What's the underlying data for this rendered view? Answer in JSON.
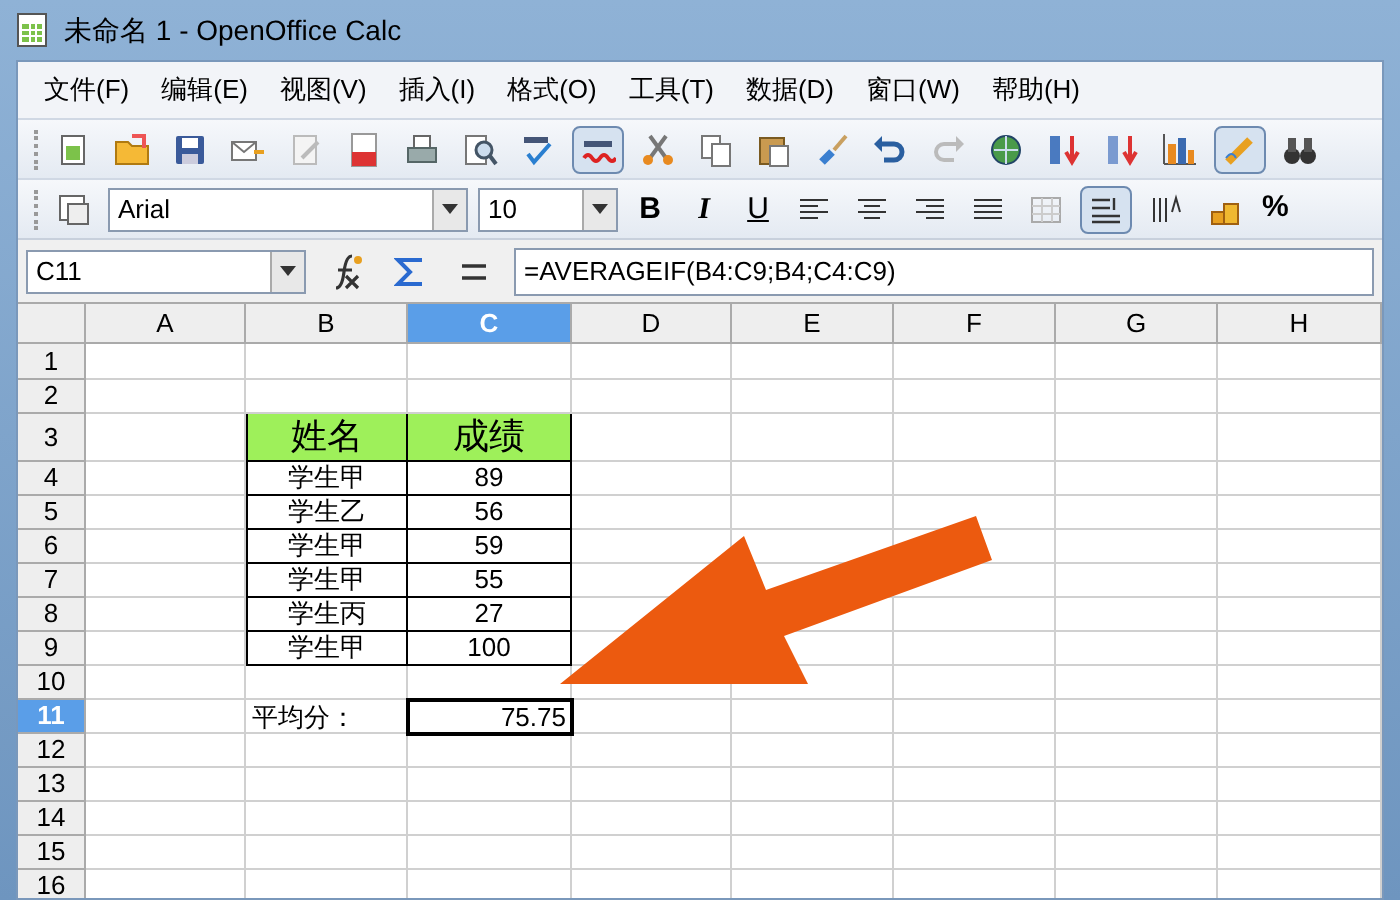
{
  "window": {
    "title": "未命名 1 - OpenOffice Calc"
  },
  "menu": [
    {
      "label": "文件(F)"
    },
    {
      "label": "编辑(E)"
    },
    {
      "label": "视图(V)"
    },
    {
      "label": "插入(I)"
    },
    {
      "label": "格式(O)"
    },
    {
      "label": "工具(T)"
    },
    {
      "label": "数据(D)"
    },
    {
      "label": "窗口(W)"
    },
    {
      "label": "帮助(H)"
    }
  ],
  "standard_toolbar": [
    {
      "kind": "new",
      "on": false
    },
    {
      "kind": "open",
      "on": false
    },
    {
      "kind": "save",
      "on": false
    },
    {
      "kind": "mail",
      "on": false
    },
    {
      "kind": "edit",
      "on": false
    },
    {
      "kind": "pdf",
      "on": false
    },
    {
      "kind": "print",
      "on": false
    },
    {
      "kind": "preview",
      "on": false
    },
    {
      "kind": "spell",
      "on": false
    },
    {
      "kind": "autospell",
      "on": true
    },
    {
      "kind": "cut",
      "on": false
    },
    {
      "kind": "copy",
      "on": false
    },
    {
      "kind": "paste",
      "on": false
    },
    {
      "kind": "brush",
      "on": false
    },
    {
      "kind": "undo",
      "on": false
    },
    {
      "kind": "redo",
      "on": false
    },
    {
      "kind": "globe",
      "on": false
    },
    {
      "kind": "sortup",
      "on": false
    },
    {
      "kind": "sortdown",
      "on": false
    },
    {
      "kind": "chart",
      "on": false
    },
    {
      "kind": "draw",
      "on": true
    },
    {
      "kind": "find",
      "on": false
    }
  ],
  "format_toolbar": {
    "font": "Arial",
    "size": "10",
    "styles": [
      {
        "label": "B",
        "on": false
      },
      {
        "label": "I",
        "on": false
      },
      {
        "label": "U",
        "on": false
      }
    ],
    "tools": [
      {
        "kind": "left",
        "on": false
      },
      {
        "kind": "center",
        "on": false
      },
      {
        "kind": "right",
        "on": false
      },
      {
        "kind": "justify",
        "on": false
      },
      {
        "kind": "merge",
        "on": false
      },
      {
        "kind": "wrap",
        "on": true
      },
      {
        "kind": "valign",
        "on": false
      },
      {
        "kind": "coins",
        "on": false
      }
    ],
    "percent": "%"
  },
  "formula_bar": {
    "cell_ref": "C11",
    "formula": "=AVERAGEIF(B4:C9;B4;C4:C9)"
  },
  "sheet": {
    "columns": [
      {
        "label": "A",
        "selected": false
      },
      {
        "label": "B",
        "selected": false
      },
      {
        "label": "C",
        "selected": true
      },
      {
        "label": "D",
        "selected": false
      },
      {
        "label": "E",
        "selected": false
      },
      {
        "label": "F",
        "selected": false
      },
      {
        "label": "G",
        "selected": false
      },
      {
        "label": "H",
        "selected": false
      }
    ],
    "rows": [
      {
        "label": "1",
        "selected": false,
        "kind": "plain",
        "cells": []
      },
      {
        "label": "2",
        "selected": false,
        "kind": "plain",
        "cells": []
      },
      {
        "label": "3",
        "selected": false,
        "kind": "header",
        "cells": [
          {
            "text": ""
          },
          {
            "text": "姓名"
          },
          {
            "text": "成绩"
          }
        ]
      },
      {
        "label": "4",
        "selected": false,
        "kind": "table",
        "cells": [
          {
            "text": ""
          },
          {
            "text": "学生甲"
          },
          {
            "text": "89"
          }
        ]
      },
      {
        "label": "5",
        "selected": false,
        "kind": "table",
        "cells": [
          {
            "text": ""
          },
          {
            "text": "学生乙"
          },
          {
            "text": "56"
          }
        ]
      },
      {
        "label": "6",
        "selected": false,
        "kind": "table",
        "cells": [
          {
            "text": ""
          },
          {
            "text": "学生甲"
          },
          {
            "text": "59"
          }
        ]
      },
      {
        "label": "7",
        "selected": false,
        "kind": "table",
        "cells": [
          {
            "text": ""
          },
          {
            "text": "学生甲"
          },
          {
            "text": "55"
          }
        ]
      },
      {
        "label": "8",
        "selected": false,
        "kind": "table",
        "cells": [
          {
            "text": ""
          },
          {
            "text": "学生丙"
          },
          {
            "text": "27"
          }
        ]
      },
      {
        "label": "9",
        "selected": false,
        "kind": "table",
        "cells": [
          {
            "text": ""
          },
          {
            "text": "学生甲"
          },
          {
            "text": "100"
          }
        ]
      },
      {
        "label": "10",
        "selected": false,
        "kind": "plain",
        "cells": []
      },
      {
        "label": "11",
        "selected": true,
        "kind": "plain",
        "cells": [
          {
            "text": ""
          },
          {
            "text": "平均分：",
            "kind": "text",
            "selected": false
          },
          {
            "text": "75.75",
            "kind": "number",
            "selected": true
          }
        ]
      },
      {
        "label": "12",
        "selected": false,
        "kind": "plain",
        "cells": []
      },
      {
        "label": "13",
        "selected": false,
        "kind": "plain",
        "cells": []
      },
      {
        "label": "14",
        "selected": false,
        "kind": "plain",
        "cells": []
      },
      {
        "label": "15",
        "selected": false,
        "kind": "plain",
        "cells": []
      },
      {
        "label": "16",
        "selected": false,
        "kind": "plain",
        "cells": []
      }
    ]
  }
}
